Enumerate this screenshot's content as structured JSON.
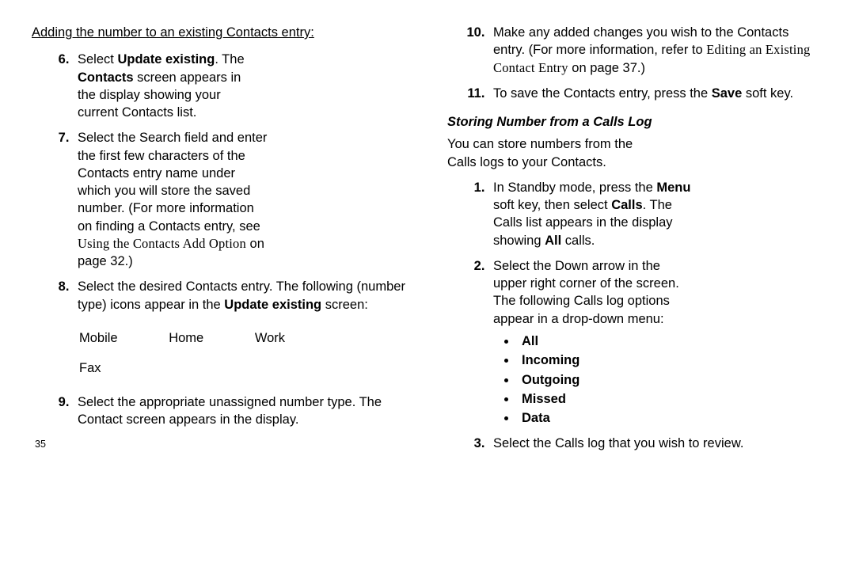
{
  "left": {
    "subhead": "Adding the number to an existing Contacts entry:",
    "item6_a": "Select ",
    "item6_b": "Update existing",
    "item6_c": ". The ",
    "item6_d": "Contacts",
    "item6_e": " screen appears in the display showing your current Contacts list.",
    "item7_a": "Select the Search field and enter the first few characters of the Contacts entry name under which you will store the saved number. (For more information on finding a Contacts entry, see  ",
    "item7_ref": "Using the Contacts Add Option",
    "item7_b": "  on page 32.)",
    "item8_a": "Select the desired Contacts entry. The following (number type) icons appear in the ",
    "item8_b": "Update existing",
    "item8_c": " screen:",
    "icons": {
      "mobile": "Mobile",
      "home": "Home",
      "work": "Work",
      "fax": "Fax"
    },
    "item9": "Select the appropriate unassigned number type. The Contact screen appears in the display.",
    "page_num": "35"
  },
  "right": {
    "item10_a": "Make any added changes you wish to the Contacts entry. (For more information, refer to  ",
    "item10_ref": "Editing an Existing Contact Entry",
    "item10_b": "  on page 37.)",
    "item11_a": "To save the Contacts entry, press the ",
    "item11_b": "Save",
    "item11_c": " soft key.",
    "section_title": "Storing Number from a Calls Log",
    "section_intro": "You can store numbers from the Calls logs to your Contacts.",
    "step1_a": "In Standby mode, press the ",
    "step1_b": "Menu",
    "step1_c": " soft key, then select ",
    "step1_d": "Calls",
    "step1_e": ". The Calls list appears in the display showing ",
    "step1_f": "All",
    "step1_g": " calls.",
    "step2": "Select the Down arrow in the upper right corner of the screen. The following Calls log options appear in a drop-down menu:",
    "bullets": {
      "b1": "All",
      "b2": "Incoming",
      "b3": "Outgoing",
      "b4": "Missed",
      "b5": "Data"
    },
    "step3": "Select the Calls log that you wish to review."
  }
}
